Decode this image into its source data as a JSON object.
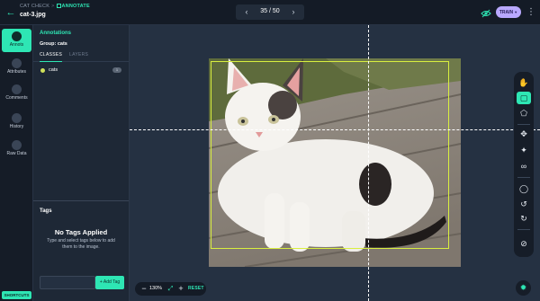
{
  "topbar": {
    "breadcrumb_parent": "CAT CHECK",
    "breadcrumb_sep": ">",
    "breadcrumb_current": "ANNOTATE",
    "filename": "cat-3.jpg",
    "pager_text": "35 / 50",
    "train_label": "TRAIN"
  },
  "nav": {
    "items": [
      {
        "label": "Annots",
        "icon": "annotate-icon"
      },
      {
        "label": "Attributes",
        "icon": "attributes-icon"
      },
      {
        "label": "Comments",
        "icon": "comments-icon"
      },
      {
        "label": "History",
        "icon": "history-icon"
      },
      {
        "label": "Raw Data",
        "icon": "raw-data-icon"
      }
    ],
    "shortcuts_label": "SHORTCUTS"
  },
  "panel": {
    "title": "Annotations",
    "group": "Group: cats",
    "tabs": [
      {
        "label": "CLASSES",
        "active": true
      },
      {
        "label": "LAYERS",
        "active": false
      }
    ],
    "classes": [
      {
        "name": "cats",
        "count": "1",
        "color": "#cfe05a"
      }
    ],
    "tags": {
      "title": "Tags",
      "empty_title": "No Tags Applied",
      "hint": "Type and select tags below to add them to the image.",
      "add_label": "+ Add Tag"
    }
  },
  "canvas": {
    "zoom_text": "130%",
    "reset_label": "RESET",
    "bbox_color": "#d9ef3f"
  },
  "tools": [
    "hand-icon",
    "bounding-box-icon",
    "polygon-icon",
    "smart-select-icon",
    "magic-wand-icon",
    "link-icon",
    "comment-icon",
    "undo-icon",
    "redo-icon",
    "no-entry-icon"
  ],
  "colors": {
    "accent": "#2ee6b4",
    "train": "#b9a8ff",
    "background": "#1b2431"
  }
}
